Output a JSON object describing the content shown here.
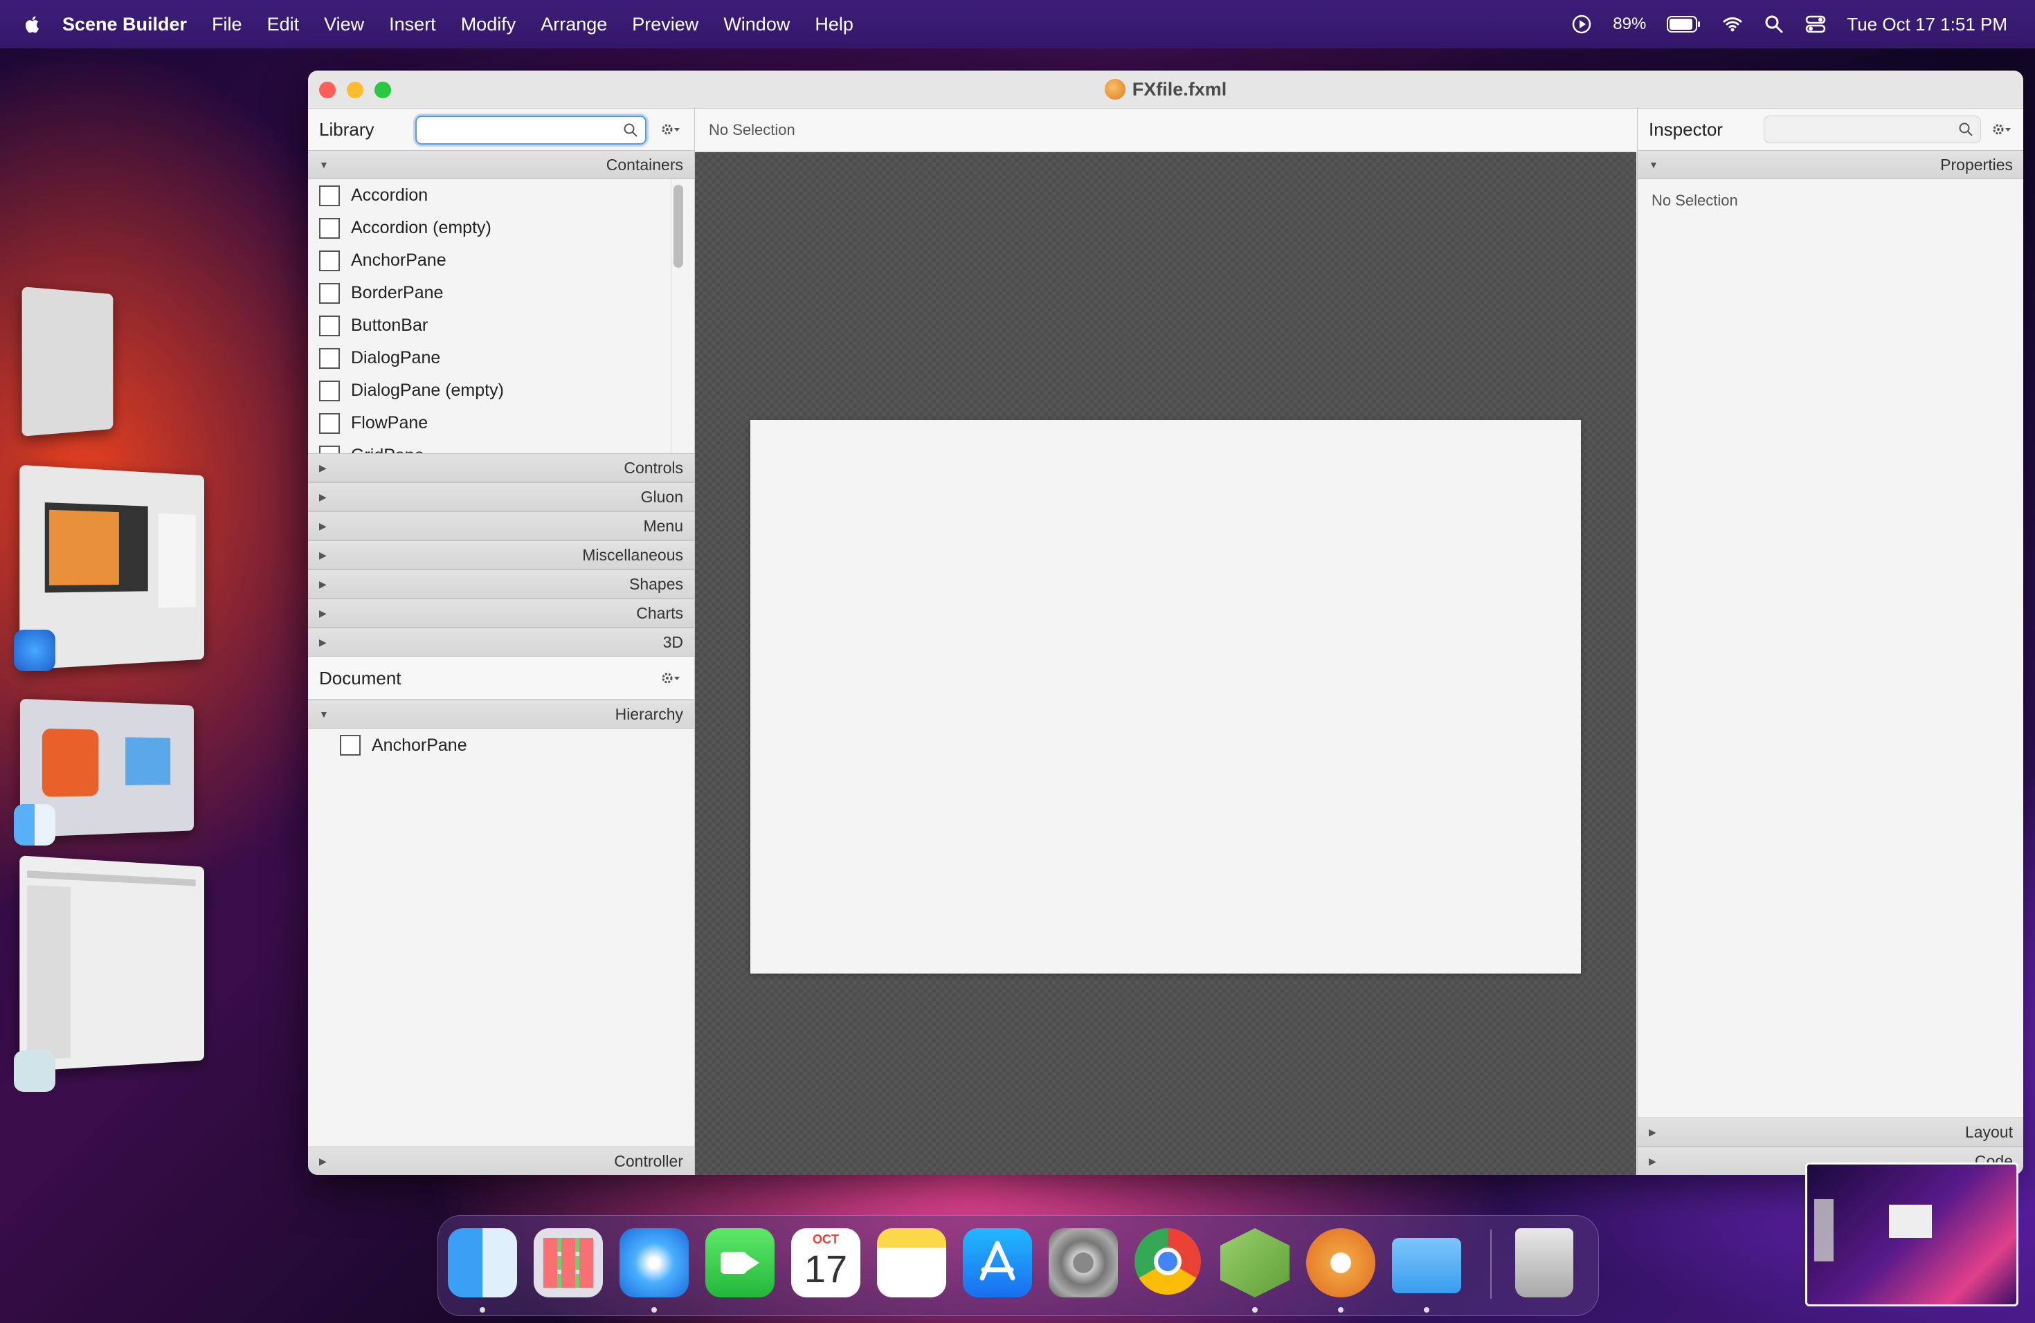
{
  "menubar": {
    "app_name": "Scene Builder",
    "menus": [
      "File",
      "Edit",
      "View",
      "Insert",
      "Modify",
      "Arrange",
      "Preview",
      "Window",
      "Help"
    ],
    "battery": "89%",
    "datetime": "Tue Oct 17  1:51 PM"
  },
  "window": {
    "title": "FXfile.fxml"
  },
  "library": {
    "header": "Library",
    "search_value": "",
    "containers_label": "Containers",
    "items": [
      "Accordion",
      "Accordion  (empty)",
      "AnchorPane",
      "BorderPane",
      "ButtonBar",
      "DialogPane",
      "DialogPane  (empty)",
      "FlowPane",
      "GridPane"
    ],
    "sections": [
      "Controls",
      "Gluon",
      "Menu",
      "Miscellaneous",
      "Shapes",
      "Charts",
      "3D"
    ]
  },
  "document": {
    "header": "Document",
    "hierarchy_label": "Hierarchy",
    "tree_root": "AnchorPane",
    "controller_label": "Controller"
  },
  "center": {
    "crumb": "No Selection"
  },
  "inspector": {
    "header": "Inspector",
    "properties_label": "Properties",
    "no_selection": "No Selection",
    "layout_label": "Layout",
    "code_label": "Code"
  },
  "dock": {
    "calendar_month": "OCT",
    "calendar_day": "17",
    "apps": [
      "finder-icon",
      "launchpad-icon",
      "safari-icon",
      "facetime-icon",
      "calendar-icon",
      "notes-icon",
      "app-store-icon",
      "system-settings-icon",
      "chrome-icon",
      "scene-builder-cube-icon",
      "scene-builder-hand-icon",
      "folder-icon",
      "trash-icon"
    ]
  }
}
